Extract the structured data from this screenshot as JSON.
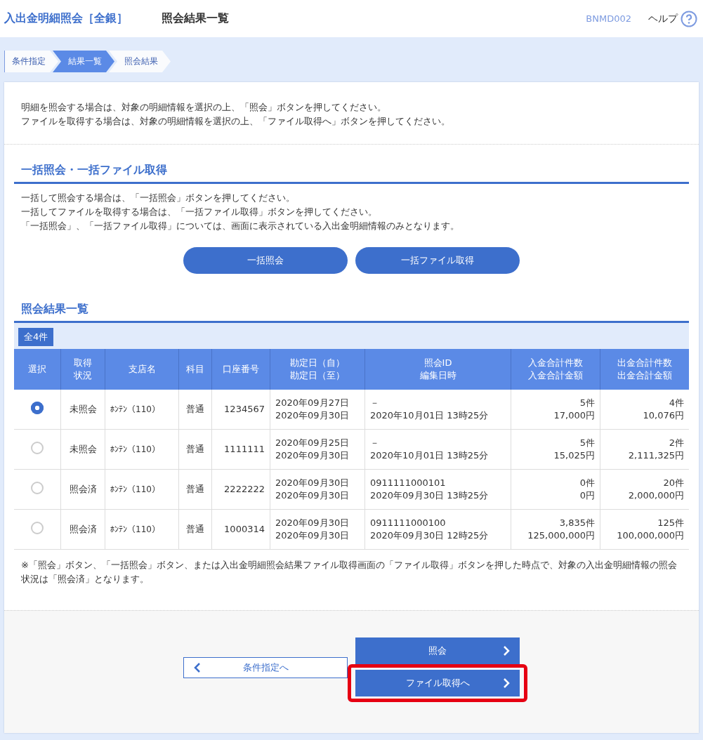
{
  "header": {
    "title": "入出金明細照会［全銀］",
    "subtitle": "照会結果一覧",
    "screen_id": "BNMD002",
    "help": "ヘルプ"
  },
  "steps": [
    {
      "label": "条件指定",
      "selected": false
    },
    {
      "label": "結果一覧",
      "selected": true
    },
    {
      "label": "照会結果",
      "selected": false
    }
  ],
  "intro": [
    "明細を照会する場合は、対象の明細情報を選択の上、「照会」ボタンを押してください。",
    "ファイルを取得する場合は、対象の明細情報を選択の上、「ファイル取得へ」ボタンを押してください。"
  ],
  "bulk": {
    "heading": "一括照会・一括ファイル取得",
    "lines": [
      "一括して照会する場合は、「一括照会」ボタンを押してください。",
      "一括してファイルを取得する場合は、「一括ファイル取得」ボタンを押してください。",
      "「一括照会」、「一括ファイル取得」については、画面に表示されている入出金明細情報のみとなります。"
    ],
    "buttons": [
      "一括照会",
      "一括ファイル取得"
    ]
  },
  "results": {
    "heading": "照会結果一覧",
    "count": "全4件",
    "columns": [
      [
        "選択"
      ],
      [
        "取得",
        "状況"
      ],
      [
        "支店名"
      ],
      [
        "科目"
      ],
      [
        "口座番号"
      ],
      [
        "勘定日（自）",
        "勘定日（至）"
      ],
      [
        "照会ID",
        "編集日時"
      ],
      [
        "入金合計件数",
        "入金合計金額"
      ],
      [
        "出金合計件数",
        "出金合計金額"
      ]
    ],
    "rows": [
      {
        "selected": true,
        "status": "未照会",
        "branch": "ﾎﾝﾃﾝ（110）",
        "type": "普通",
        "account": "1234567",
        "dates": [
          "2020年09月27日",
          "2020年09月30日"
        ],
        "id": [
          "－",
          "2020年10月01日 13時25分"
        ],
        "deposit": [
          "5件",
          "17,000円"
        ],
        "withdrawal": [
          "4件",
          "10,076円"
        ]
      },
      {
        "selected": false,
        "status": "未照会",
        "branch": "ﾎﾝﾃﾝ（110）",
        "type": "普通",
        "account": "1111111",
        "dates": [
          "2020年09月25日",
          "2020年09月30日"
        ],
        "id": [
          "－",
          "2020年10月01日 13時25分"
        ],
        "deposit": [
          "5件",
          "15,025円"
        ],
        "withdrawal": [
          "2件",
          "2,111,325円"
        ]
      },
      {
        "selected": false,
        "status": "照会済",
        "branch": "ﾎﾝﾃﾝ（110）",
        "type": "普通",
        "account": "2222222",
        "dates": [
          "2020年09月30日",
          "2020年09月30日"
        ],
        "id": [
          "0911111000101",
          "2020年09月30日 13時25分"
        ],
        "deposit": [
          "0件",
          "0円"
        ],
        "withdrawal": [
          "20件",
          "2,000,000円"
        ]
      },
      {
        "selected": false,
        "status": "照会済",
        "branch": "ﾎﾝﾃﾝ（110）",
        "type": "普通",
        "account": "1000314",
        "dates": [
          "2020年09月30日",
          "2020年09月30日"
        ],
        "id": [
          "0911111000100",
          "2020年09月30日 12時25分"
        ],
        "deposit": [
          "3,835件",
          "125,000,000円"
        ],
        "withdrawal": [
          "125件",
          "100,000,000円"
        ]
      }
    ],
    "note": "※「照会」ボタン、「一括照会」ボタン、または入出金明細照会結果ファイル取得画面の「ファイル取得」ボタンを押した時点で、対象の入出金明細情報の照会状況は「照会済」となります。"
  },
  "footer": {
    "back": "条件指定へ",
    "inquire": "照会",
    "file": {
      "label": "ファイル取得へ",
      "highlighted": true
    }
  }
}
